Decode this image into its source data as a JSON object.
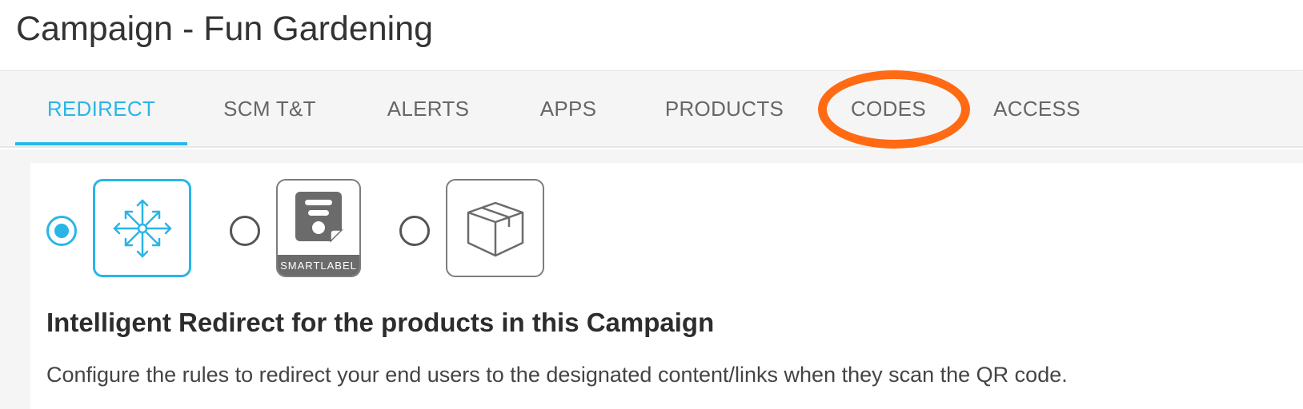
{
  "page": {
    "title": "Campaign - Fun Gardening"
  },
  "tabs": [
    {
      "label": "REDIRECT",
      "active": true
    },
    {
      "label": "SCM T&T",
      "active": false
    },
    {
      "label": "ALERTS",
      "active": false
    },
    {
      "label": "APPS",
      "active": false
    },
    {
      "label": "PRODUCTS",
      "active": false
    },
    {
      "label": "CODES",
      "active": false,
      "highlighted": true
    },
    {
      "label": "ACCESS",
      "active": false
    }
  ],
  "redirect_options": [
    {
      "icon": "arrows-expand-icon",
      "label": "",
      "selected": true
    },
    {
      "icon": "smartlabel-icon",
      "label": "SMARTLABEL",
      "selected": false
    },
    {
      "icon": "package-box-icon",
      "label": "",
      "selected": false
    }
  ],
  "section": {
    "heading": "Intelligent Redirect for the products in this Campaign",
    "description": "Configure the rules to redirect your end users to the designated content/links when they scan the QR code."
  },
  "colors": {
    "accent": "#29b6e6",
    "highlight": "#ff6a13",
    "text": "#333333",
    "tab_text": "#666666"
  }
}
